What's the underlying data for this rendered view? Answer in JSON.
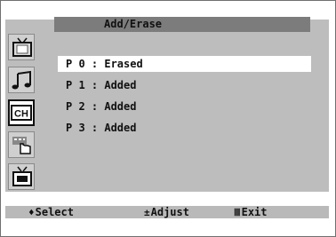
{
  "menu": {
    "title": "Add/Erase",
    "items": [
      {
        "label": "P 0 : Erased",
        "selected": true
      },
      {
        "label": "P 1 : Added",
        "selected": false
      },
      {
        "label": "P 2 : Added",
        "selected": false
      },
      {
        "label": "P 3 : Added",
        "selected": false
      }
    ]
  },
  "sidebar": {
    "items": [
      {
        "icon": "tv-picture-icon"
      },
      {
        "icon": "music-note-icon"
      },
      {
        "icon": "channel-icon",
        "label": "CH",
        "active": true
      },
      {
        "icon": "setup-hand-icon"
      },
      {
        "icon": "input-source-icon"
      }
    ]
  },
  "status": {
    "select": {
      "glyph": "♦",
      "label": "Select"
    },
    "adjust": {
      "glyph": "±",
      "label": "Adjust"
    },
    "exit": {
      "glyph": "Ⅲ",
      "label": "Exit"
    }
  }
}
